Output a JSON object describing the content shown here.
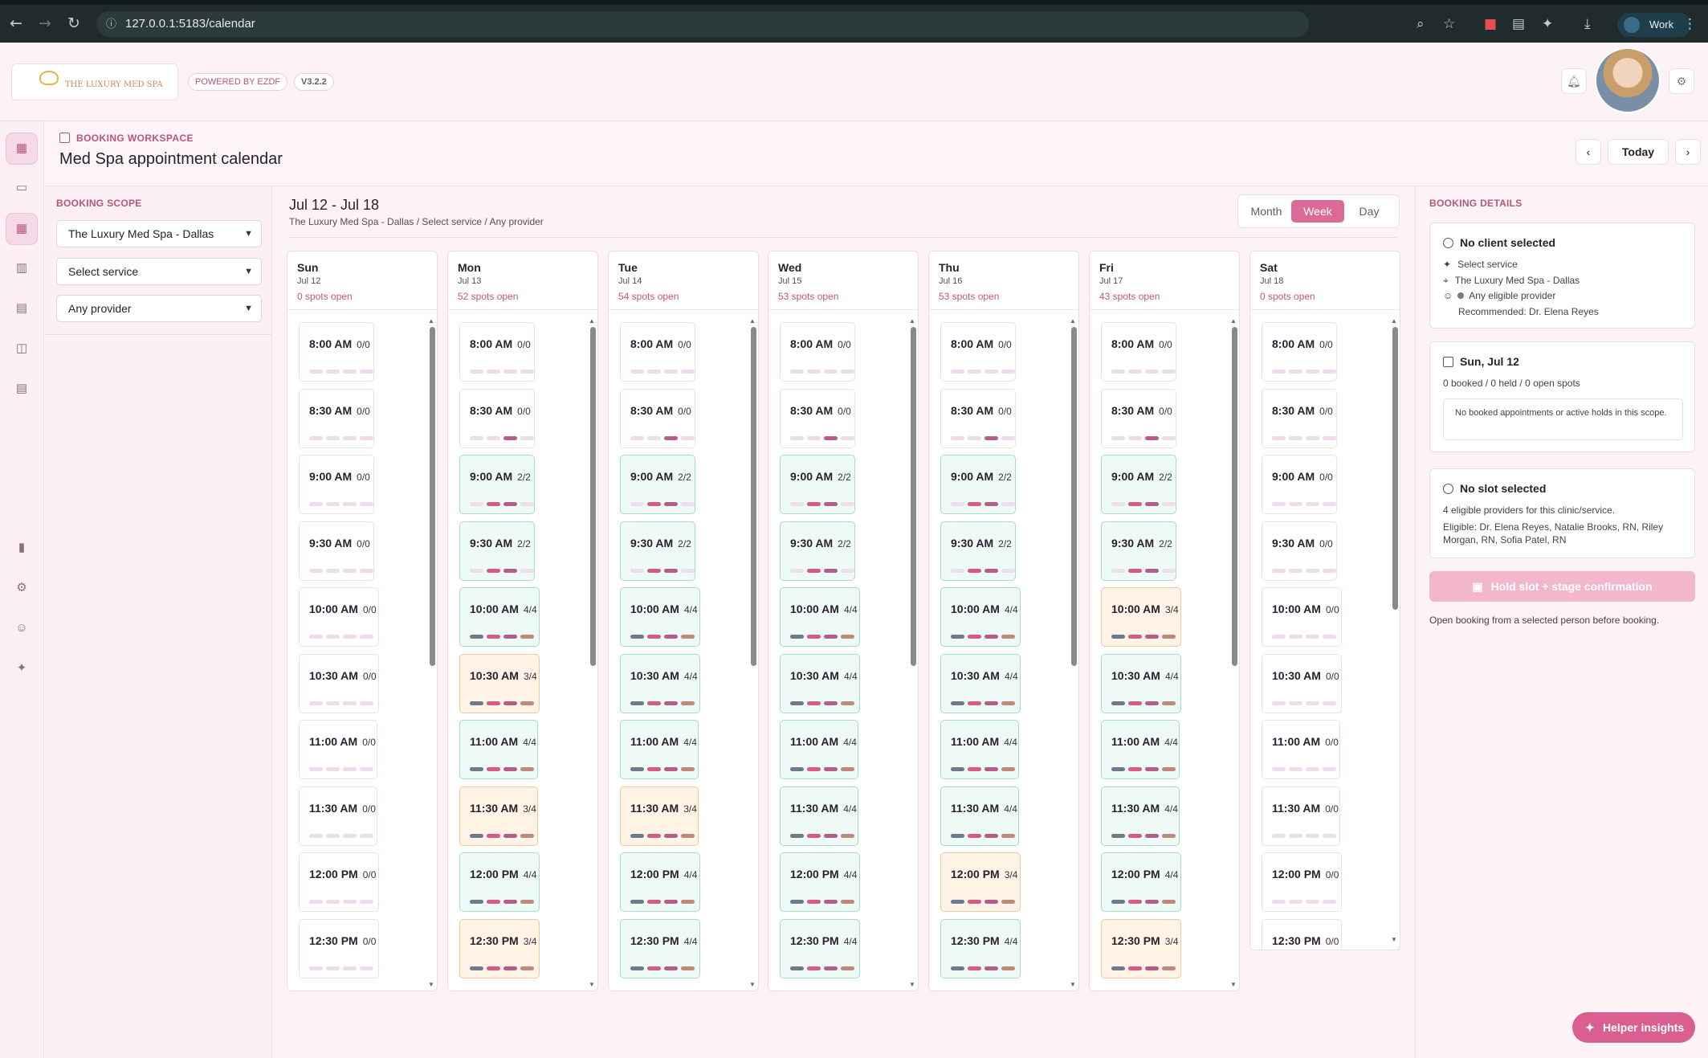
{
  "browser": {
    "url": "127.0.0.1:5183/calendar",
    "profile": "Work"
  },
  "header": {
    "brand": "THE LUXURY MED SPA",
    "powered": "POWERED BY EZDF",
    "version": "V3.2.2"
  },
  "workspace": {
    "eyebrow": "BOOKING WORKSPACE",
    "title": "Med Spa appointment calendar",
    "today": "Today"
  },
  "scope": {
    "label": "BOOKING SCOPE",
    "clinic": "The Luxury Med Spa - Dallas",
    "service": "Select service",
    "provider": "Any provider"
  },
  "calendar": {
    "range": "Jul 12 - Jul 18",
    "subtitle": "The Luxury Med Spa - Dallas / Select service / Any provider",
    "views": [
      "Month",
      "Week",
      "Day"
    ],
    "active_view": "Week",
    "days": [
      {
        "day": "Sun",
        "date": "Jul 12",
        "open": "0 spots open",
        "slots": [
          [
            "8:00 AM",
            "0/0",
            "e"
          ],
          [
            "8:30 AM",
            "0/0",
            "e"
          ],
          [
            "9:00 AM",
            "0/0",
            "e"
          ],
          [
            "9:30 AM",
            "0/0",
            "e"
          ],
          [
            "10:00 AM",
            "0/0",
            "e"
          ],
          [
            "10:30 AM",
            "0/0",
            "e"
          ],
          [
            "11:00 AM",
            "0/0",
            "e"
          ],
          [
            "11:30 AM",
            "0/0",
            "e"
          ],
          [
            "12:00 PM",
            "0/0",
            "e"
          ],
          [
            "12:30 PM",
            "0/0",
            "e"
          ]
        ]
      },
      {
        "day": "Mon",
        "date": "Jul 13",
        "open": "52 spots open",
        "slots": [
          [
            "8:00 AM",
            "0/0",
            "e"
          ],
          [
            "8:30 AM",
            "0/0",
            "e1"
          ],
          [
            "9:00 AM",
            "2/2",
            "f2"
          ],
          [
            "9:30 AM",
            "2/2",
            "f2"
          ],
          [
            "10:00 AM",
            "4/4",
            "f4"
          ],
          [
            "10:30 AM",
            "3/4",
            "p4"
          ],
          [
            "11:00 AM",
            "4/4",
            "f4"
          ],
          [
            "11:30 AM",
            "3/4",
            "p4"
          ],
          [
            "12:00 PM",
            "4/4",
            "f4"
          ],
          [
            "12:30 PM",
            "3/4",
            "p4"
          ]
        ]
      },
      {
        "day": "Tue",
        "date": "Jul 14",
        "open": "54 spots open",
        "slots": [
          [
            "8:00 AM",
            "0/0",
            "e"
          ],
          [
            "8:30 AM",
            "0/0",
            "e1"
          ],
          [
            "9:00 AM",
            "2/2",
            "f2"
          ],
          [
            "9:30 AM",
            "2/2",
            "f2"
          ],
          [
            "10:00 AM",
            "4/4",
            "f4"
          ],
          [
            "10:30 AM",
            "4/4",
            "f4"
          ],
          [
            "11:00 AM",
            "4/4",
            "f4"
          ],
          [
            "11:30 AM",
            "3/4",
            "p4"
          ],
          [
            "12:00 PM",
            "4/4",
            "f4"
          ],
          [
            "12:30 PM",
            "4/4",
            "f4"
          ]
        ]
      },
      {
        "day": "Wed",
        "date": "Jul 15",
        "open": "53 spots open",
        "slots": [
          [
            "8:00 AM",
            "0/0",
            "e"
          ],
          [
            "8:30 AM",
            "0/0",
            "e1"
          ],
          [
            "9:00 AM",
            "2/2",
            "f2"
          ],
          [
            "9:30 AM",
            "2/2",
            "f2"
          ],
          [
            "10:00 AM",
            "4/4",
            "f4"
          ],
          [
            "10:30 AM",
            "4/4",
            "f4"
          ],
          [
            "11:00 AM",
            "4/4",
            "f4"
          ],
          [
            "11:30 AM",
            "4/4",
            "f4"
          ],
          [
            "12:00 PM",
            "4/4",
            "f4"
          ],
          [
            "12:30 PM",
            "4/4",
            "f4"
          ]
        ]
      },
      {
        "day": "Thu",
        "date": "Jul 16",
        "open": "53 spots open",
        "slots": [
          [
            "8:00 AM",
            "0/0",
            "e"
          ],
          [
            "8:30 AM",
            "0/0",
            "e1"
          ],
          [
            "9:00 AM",
            "2/2",
            "f2"
          ],
          [
            "9:30 AM",
            "2/2",
            "f2"
          ],
          [
            "10:00 AM",
            "4/4",
            "f4"
          ],
          [
            "10:30 AM",
            "4/4",
            "f4"
          ],
          [
            "11:00 AM",
            "4/4",
            "f4"
          ],
          [
            "11:30 AM",
            "4/4",
            "f4"
          ],
          [
            "12:00 PM",
            "3/4",
            "p4"
          ],
          [
            "12:30 PM",
            "4/4",
            "f4"
          ]
        ]
      },
      {
        "day": "Fri",
        "date": "Jul 17",
        "open": "43 spots open",
        "slots": [
          [
            "8:00 AM",
            "0/0",
            "e"
          ],
          [
            "8:30 AM",
            "0/0",
            "e1"
          ],
          [
            "9:00 AM",
            "2/2",
            "f2"
          ],
          [
            "9:30 AM",
            "2/2",
            "f2"
          ],
          [
            "10:00 AM",
            "3/4",
            "p4"
          ],
          [
            "10:30 AM",
            "4/4",
            "f4"
          ],
          [
            "11:00 AM",
            "4/4",
            "f4"
          ],
          [
            "11:30 AM",
            "4/4",
            "f4"
          ],
          [
            "12:00 PM",
            "4/4",
            "f4"
          ],
          [
            "12:30 PM",
            "3/4",
            "p4"
          ]
        ]
      },
      {
        "day": "Sat",
        "date": "Jul 18",
        "open": "0 spots open",
        "slots": [
          [
            "8:00 AM",
            "0/0",
            "e"
          ],
          [
            "8:30 AM",
            "0/0",
            "e"
          ],
          [
            "9:00 AM",
            "0/0",
            "e"
          ],
          [
            "9:30 AM",
            "0/0",
            "e"
          ],
          [
            "10:00 AM",
            "0/0",
            "e"
          ],
          [
            "10:30 AM",
            "0/0",
            "e"
          ],
          [
            "11:00 AM",
            "0/0",
            "e"
          ],
          [
            "11:30 AM",
            "0/0",
            "e"
          ],
          [
            "12:00 PM",
            "0/0",
            "e"
          ],
          [
            "12:30 PM",
            "0/0",
            "e"
          ]
        ]
      }
    ]
  },
  "details": {
    "label": "BOOKING DETAILS",
    "client": {
      "title": "No client selected",
      "service": "Select service",
      "clinic": "The Luxury Med Spa - Dallas",
      "provider": "Any eligible provider",
      "recommended": "Recommended: Dr. Elena Reyes"
    },
    "day": {
      "title": "Sun, Jul 12",
      "summary": "0 booked / 0 held / 0 open spots",
      "empty": "No booked appointments or active holds in this scope."
    },
    "slot": {
      "title": "No slot selected",
      "line1": "4 eligible providers for this clinic/service.",
      "eligible": "Eligible: Dr. Elena Reyes, Natalie Brooks, RN, Riley Morgan, RN, Sofia Patel, RN"
    },
    "hold_button": "Hold slot + stage confirmation",
    "note": "Open booking from a selected person before booking."
  },
  "helper": "Helper insights",
  "colors": {
    "accent": "#db6a97",
    "full": "#eefaf5",
    "partial": "#fef3e4",
    "bar_gray": "#6e7a8c",
    "bar_pink": "#d65a86",
    "bar_mauve": "#b45c8a",
    "bar_tan": "#c08a7a"
  }
}
